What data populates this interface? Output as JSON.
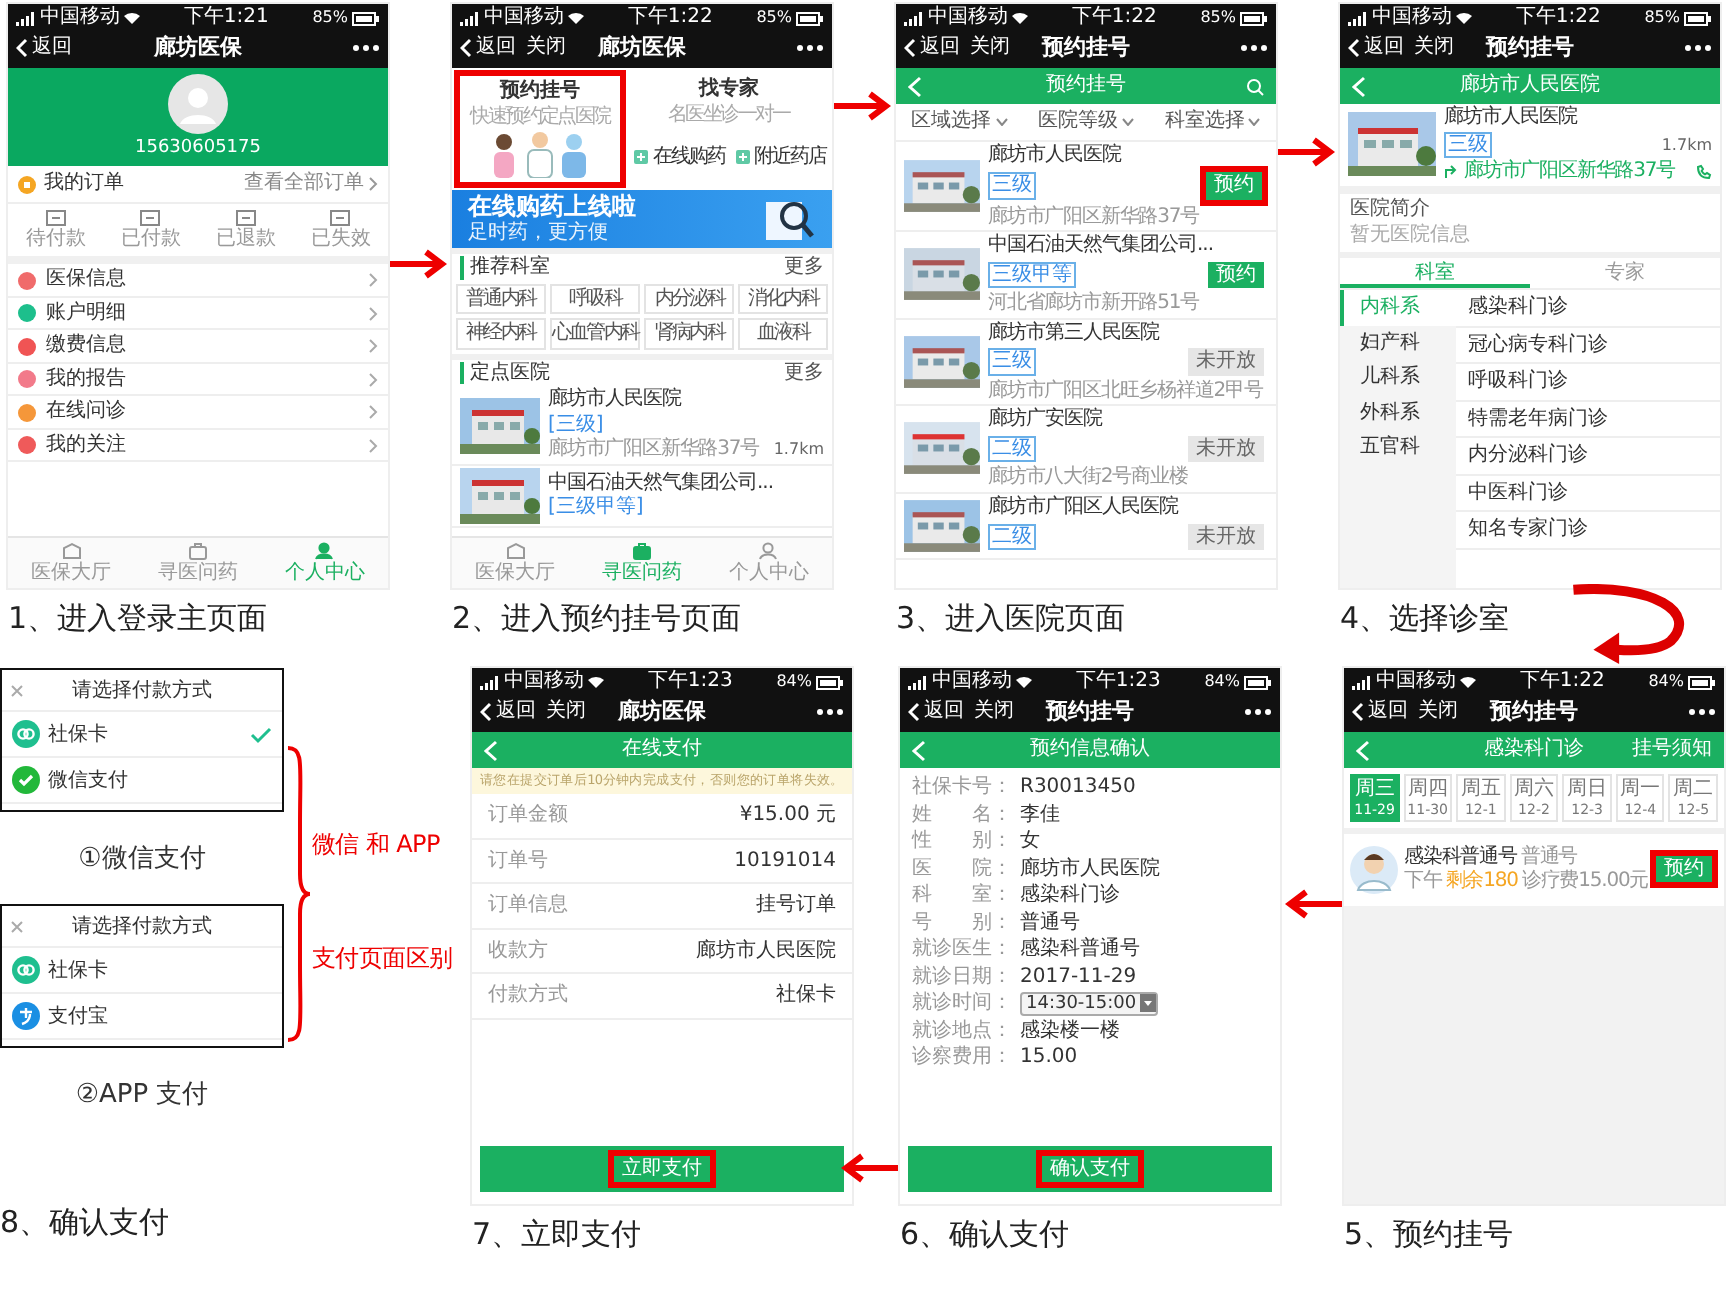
{
  "steps": [
    {
      "kind": "profile",
      "caption": "1、进入登录主页面",
      "status": {
        "carrier": "中国移动",
        "time": "下午1:21",
        "battery": "85%"
      },
      "nav": {
        "back": "返回",
        "title": "廊坊医保"
      },
      "phone_number": "15630605175",
      "orders": {
        "title": "我的订单",
        "link": "查看全部订单"
      },
      "order_tabs": [
        "待付款",
        "已付款",
        "已退款",
        "已失效"
      ],
      "menu": [
        {
          "label": "医保信息",
          "color": "#f06b6b"
        },
        {
          "label": "账户明细",
          "color": "#1dbf8c"
        },
        {
          "label": "缴费信息",
          "color": "#f05454"
        },
        {
          "label": "我的报告",
          "color": "#f27a8a"
        },
        {
          "label": "在线问诊",
          "color": "#f5973a"
        },
        {
          "label": "我的关注",
          "color": "#ef5a5a"
        }
      ],
      "tabbar": [
        {
          "label": "医保大厅",
          "selected": false
        },
        {
          "label": "寻医问药",
          "selected": false
        },
        {
          "label": "个人中心",
          "selected": true
        }
      ]
    },
    {
      "kind": "home",
      "caption": "2、进入预约挂号页面",
      "status": {
        "carrier": "中国移动",
        "time": "下午1:22",
        "battery": "85%"
      },
      "nav": {
        "back": "返回",
        "close": "关闭",
        "title": "廊坊医保"
      },
      "tiles": [
        {
          "title": "预约挂号",
          "subtitle": "快速预约定点医院",
          "highlighted": true
        },
        {
          "title": "找专家",
          "subtitle": "名医坐诊一对一",
          "highlighted": false
        },
        {
          "title": "在线购药",
          "highlighted": false
        },
        {
          "title": "附近药店",
          "highlighted": false
        }
      ],
      "banner": {
        "title": "在线购药上线啦",
        "subtitle": "足时药，更方便"
      },
      "dept_section": {
        "title": "推荐科室",
        "more": "更多"
      },
      "departments": [
        "普通内科",
        "呼吸科",
        "内分泌科",
        "消化内科",
        "神经内科",
        "心血管内科",
        "肾病内科",
        "血液科"
      ],
      "hospital_section": {
        "title": "定点医院",
        "more": "更多"
      },
      "hospitals": [
        {
          "name": "廊坊市人民医院",
          "grade": "[三级]",
          "address": "廊坊市广阳区新华路37号",
          "distance": "1.7km"
        },
        {
          "name": "中国石油天然气集团公司...",
          "grade": "[三级甲等]"
        }
      ],
      "tabbar": [
        {
          "label": "医保大厅",
          "selected": false
        },
        {
          "label": "寻医问药",
          "selected": true
        },
        {
          "label": "个人中心",
          "selected": false
        }
      ]
    },
    {
      "kind": "hospitals",
      "caption": "3、进入医院页面",
      "status": {
        "carrier": "中国移动",
        "time": "下午1:22",
        "battery": "85%"
      },
      "nav": {
        "back": "返回",
        "close": "关闭",
        "title": "预约挂号"
      },
      "header": {
        "title": "预约挂号"
      },
      "filters": [
        "区域选择",
        "医院等级",
        "科室选择"
      ],
      "hospitals": [
        {
          "name": "廊坊市人民医院",
          "grade": "三级",
          "address": "廊坊市广阳区新华路37号",
          "button": "预约",
          "enabled": true,
          "highlighted": true
        },
        {
          "name": "中国石油天然气集团公司...",
          "grade": "三级甲等",
          "address": "河北省廊坊市新开路51号",
          "button": "预约",
          "enabled": true,
          "highlighted": false
        },
        {
          "name": "廊坊市第三人民医院",
          "grade": "三级",
          "address": "廊坊市广阳区北旺乡杨祥道2甲号",
          "button": "未开放",
          "enabled": false,
          "highlighted": false
        },
        {
          "name": "廊坊广安医院",
          "grade": "二级",
          "address": "廊坊市八大街2号商业楼",
          "button": "未开放",
          "enabled": false,
          "highlighted": false
        },
        {
          "name": "廊坊市广阳区人民医院",
          "grade": "二级",
          "button": "未开放",
          "enabled": false,
          "highlighted": false
        }
      ]
    },
    {
      "kind": "hospital_detail",
      "caption": "4、选择诊室",
      "status": {
        "carrier": "中国移动",
        "time": "下午1:22",
        "battery": "85%"
      },
      "nav": {
        "back": "返回",
        "close": "关闭",
        "title": "预约挂号"
      },
      "header": {
        "title": "廊坊市人民医院"
      },
      "hospital": {
        "name": "廊坊市人民医院",
        "grade": "三级",
        "distance": "1.7km",
        "address": "廊坊市广阳区新华路37号"
      },
      "intro": {
        "title": "医院简介",
        "text": "暂无医院信息"
      },
      "tabs": [
        {
          "label": "科室",
          "selected": true
        },
        {
          "label": "专家",
          "selected": false
        }
      ],
      "categories": [
        {
          "label": "内科系",
          "selected": true
        },
        {
          "label": "妇产科",
          "selected": false
        },
        {
          "label": "儿科系",
          "selected": false
        },
        {
          "label": "外科系",
          "selected": false
        },
        {
          "label": "五官科",
          "selected": false
        }
      ],
      "clinics": [
        "感染科门诊",
        "冠心病专科门诊",
        "呼吸科门诊",
        "特需老年病门诊",
        "内分泌科门诊",
        "中医科门诊",
        "知名专家门诊"
      ]
    },
    {
      "kind": "payment",
      "caption": "8、确认支付",
      "popups": [
        {
          "title": "请选择付款方式",
          "options": [
            {
              "label": "社保卡",
              "kind": "social-card",
              "checked": true
            },
            {
              "label": "微信支付",
              "kind": "wechat",
              "checked": false
            }
          ],
          "label": "①微信支付"
        },
        {
          "title": "请选择付款方式",
          "options": [
            {
              "label": "社保卡",
              "kind": "social-card",
              "checked": false
            },
            {
              "label": "支付宝",
              "kind": "alipay",
              "checked": false
            }
          ],
          "label": "②APP 支付"
        }
      ],
      "note": [
        "微信 和 APP",
        "支付页面区别"
      ]
    },
    {
      "kind": "pay",
      "caption": "7、立即支付",
      "status": {
        "carrier": "中国移动",
        "time": "下午1:23",
        "battery": "84%"
      },
      "nav": {
        "back": "返回",
        "close": "关闭",
        "title": "廊坊医保"
      },
      "header": {
        "title": "在线支付"
      },
      "notice": "请您在提交订单后10分钟内完成支付，否则您的订单将失效。",
      "rows": [
        {
          "label": "订单金额",
          "value": "¥15.00 元"
        },
        {
          "label": "订单号",
          "value": "10191014"
        },
        {
          "label": "订单信息",
          "value": "挂号订单"
        },
        {
          "label": "收款方",
          "value": "廊坊市人民医院"
        },
        {
          "label": "付款方式",
          "value": "社保卡"
        }
      ],
      "button": {
        "label": "立即支付",
        "highlighted": true
      }
    },
    {
      "kind": "confirm",
      "caption": "6、确认支付",
      "status": {
        "carrier": "中国移动",
        "time": "下午1:23",
        "battery": "84%"
      },
      "nav": {
        "back": "返回",
        "close": "关闭",
        "title": "预约挂号"
      },
      "header": {
        "title": "预约信息确认"
      },
      "fields": [
        {
          "label": "社保卡号：",
          "value": "R30013450",
          "kind": "text"
        },
        {
          "label": "姓　　名：",
          "value": "李佳",
          "kind": "text"
        },
        {
          "label": "性　　别：",
          "value": "女",
          "kind": "text"
        },
        {
          "label": "医　　院：",
          "value": "廊坊市人民医院",
          "kind": "text"
        },
        {
          "label": "科　　室：",
          "value": "感染科门诊",
          "kind": "text"
        },
        {
          "label": "号　　别：",
          "value": "普通号",
          "kind": "text"
        },
        {
          "label": "就诊医生：",
          "value": "感染科普通号",
          "kind": "text"
        },
        {
          "label": "就诊日期：",
          "value": "2017-11-29",
          "kind": "text"
        },
        {
          "label": "就诊时间：",
          "value": "14:30-15:00",
          "kind": "select"
        },
        {
          "label": "就诊地点：",
          "value": "感染楼一楼",
          "kind": "text"
        },
        {
          "label": "诊察费用：",
          "value": "15.00",
          "kind": "text"
        }
      ],
      "button": {
        "label": "确认支付",
        "highlighted": true
      }
    },
    {
      "kind": "schedule",
      "caption": "5、预约挂号",
      "status": {
        "carrier": "中国移动",
        "time": "下午1:22",
        "battery": "84%"
      },
      "nav": {
        "back": "返回",
        "close": "关闭",
        "title": "预约挂号"
      },
      "header": {
        "title": "感染科门诊",
        "action": "挂号须知"
      },
      "dates": [
        {
          "weekday": "周三",
          "date": "11-29",
          "selected": true
        },
        {
          "weekday": "周四",
          "date": "11-30",
          "selected": false
        },
        {
          "weekday": "周五",
          "date": "12-1",
          "selected": false
        },
        {
          "weekday": "周六",
          "date": "12-2",
          "selected": false
        },
        {
          "weekday": "周日",
          "date": "12-3",
          "selected": false
        },
        {
          "weekday": "周一",
          "date": "12-4",
          "selected": false
        },
        {
          "weekday": "周二",
          "date": "12-5",
          "selected": false
        }
      ],
      "doctor": {
        "name": "感染科普通号",
        "type": "普通号",
        "period": "下午",
        "remaining": "剩余180",
        "fee": "诊疗费15.00元",
        "button": "预约",
        "highlighted": true
      }
    }
  ]
}
